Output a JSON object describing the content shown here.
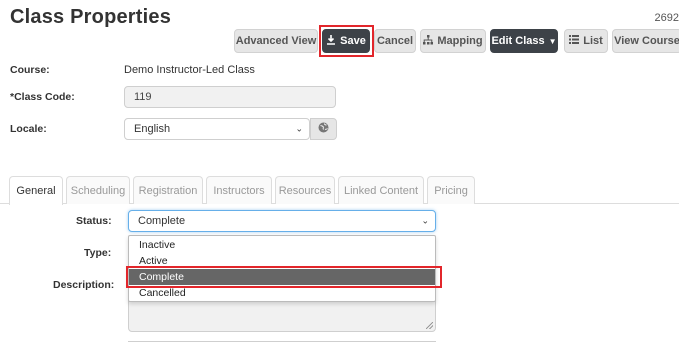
{
  "header": {
    "title": "Class Properties",
    "record_id": "2692"
  },
  "toolbar": {
    "advanced_view": "Advanced View",
    "save": "Save",
    "cancel": "Cancel",
    "mapping": "Mapping",
    "edit_class": "Edit Class",
    "list": "List",
    "view_course": "View Course"
  },
  "form": {
    "course_label": "Course:",
    "course_value": "Demo Instructor-Led Class",
    "class_code_label": "*Class Code:",
    "class_code_value": "119",
    "locale_label": "Locale:",
    "locale_value": "English"
  },
  "tabs": [
    "General",
    "Scheduling",
    "Registration",
    "Instructors",
    "Resources",
    "Linked Content",
    "Pricing"
  ],
  "general": {
    "status_label": "Status:",
    "status_value": "Complete",
    "status_options": [
      "Inactive",
      "Active",
      "Complete",
      "Cancelled"
    ],
    "type_label": "Type:",
    "description_label": "Description:"
  },
  "colors": {
    "highlight": "#e2262b",
    "dark_button": "#3d4248",
    "selected_option": "#666666"
  }
}
